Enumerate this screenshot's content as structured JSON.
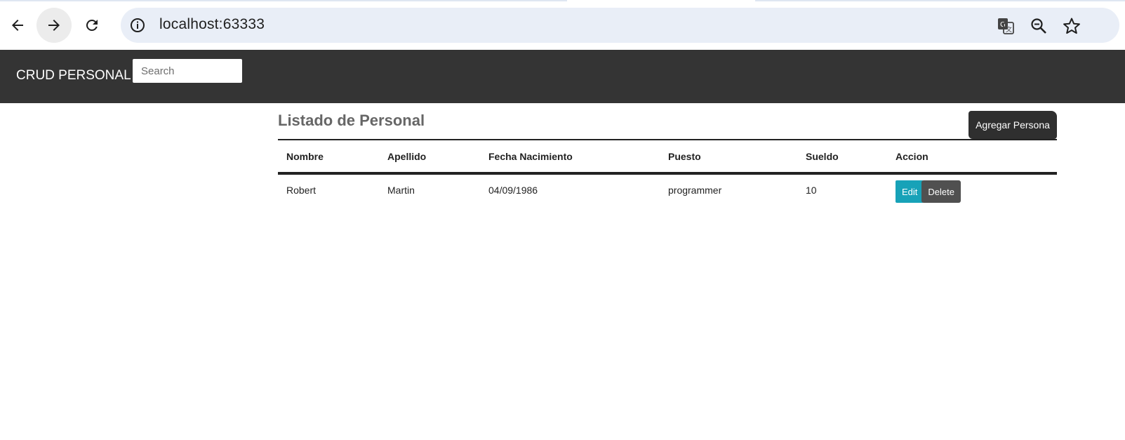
{
  "browser": {
    "url": "localhost:63333",
    "back_icon": "arrow-left-icon",
    "forward_icon": "arrow-right-icon",
    "reload_icon": "reload-icon",
    "site_info_icon": "info-icon",
    "translate_icon": "translate-icon",
    "zoom_icon": "zoom-out-icon",
    "bookmark_icon": "star-icon"
  },
  "navbar": {
    "brand": "CRUD PERSONAL",
    "search_placeholder": "Search",
    "background_color": "#343434"
  },
  "main": {
    "title": "Listado de Personal",
    "add_button_label": "Agregar Persona",
    "table": {
      "headers": [
        "Nombre",
        "Apellido",
        "Fecha Nacimiento",
        "Puesto",
        "Sueldo",
        "Accion"
      ],
      "rows": [
        {
          "nombre": "Robert",
          "apellido": "Martin",
          "fecha_nacimiento": "04/09/1986",
          "puesto": "programmer",
          "sueldo": "10",
          "edit_label": "Edit",
          "delete_label": "Delete"
        }
      ]
    }
  },
  "colors": {
    "edit_button": "#17a2b8",
    "delete_button": "#505050",
    "add_button": "#2f2f2f"
  }
}
